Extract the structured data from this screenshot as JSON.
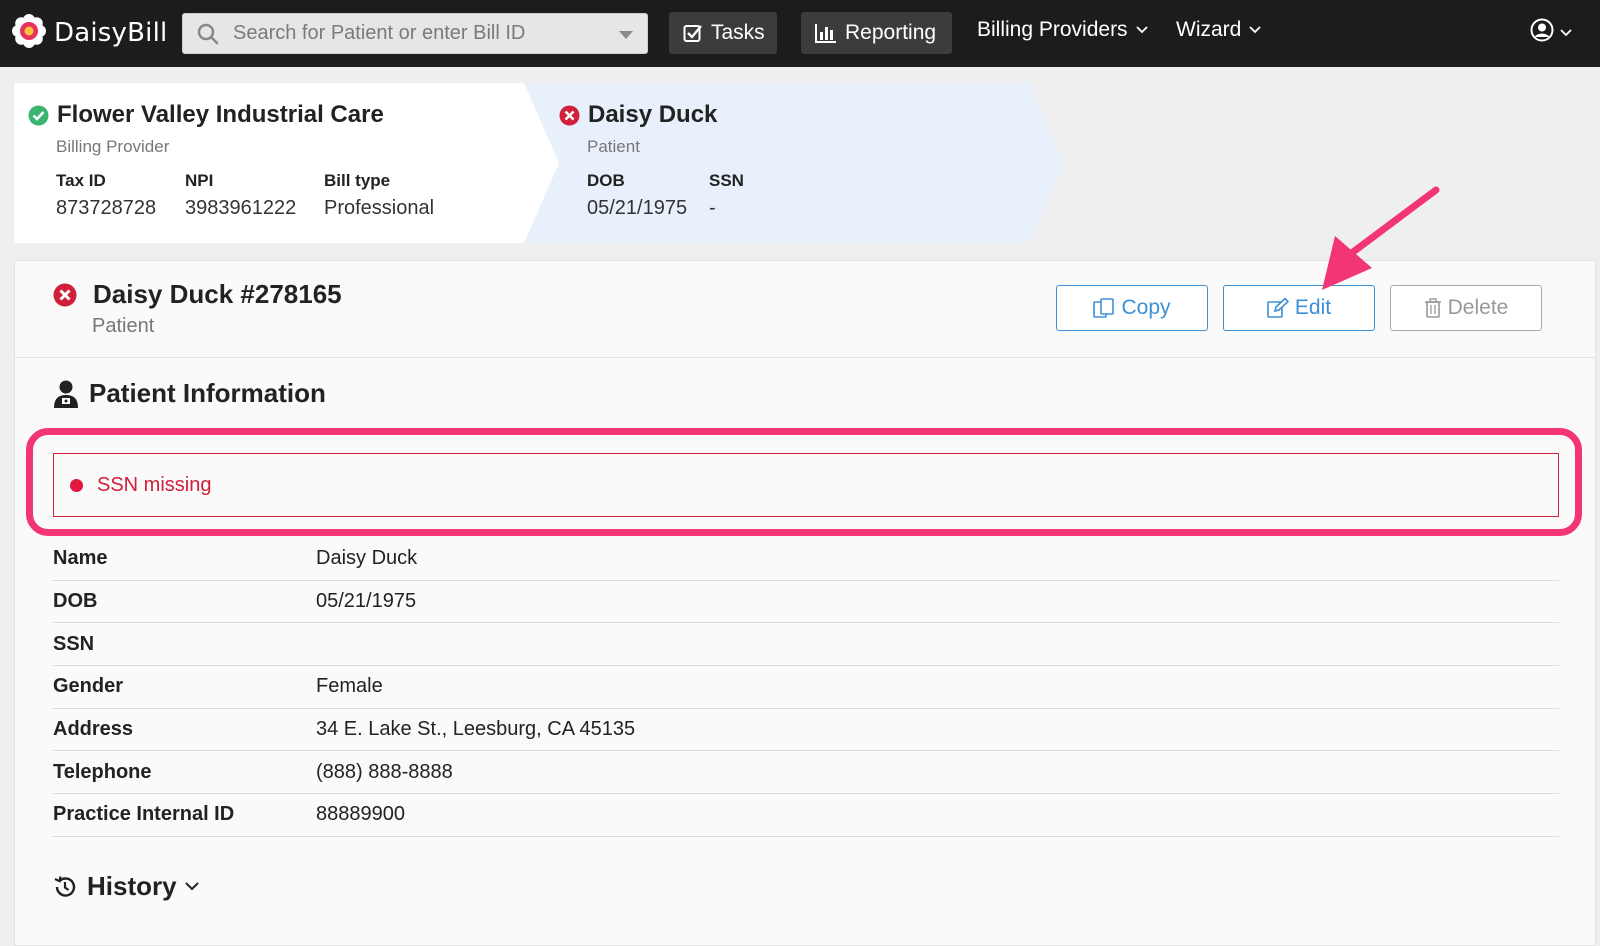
{
  "app": {
    "brand": "DaisyBill",
    "colors": {
      "navbar": "#1c1c1c",
      "accent_blue": "#3d8fd6",
      "error_red": "#d0203a",
      "annotation_pink": "#f23574",
      "success_green": "#3bb56f"
    }
  },
  "navbar": {
    "search": {
      "placeholder": "Search for Patient or enter Bill ID",
      "icon": "search-icon"
    },
    "tasks_label": "Tasks",
    "reporting_label": "Reporting",
    "billing_providers_label": "Billing Providers",
    "wizard_label": "Wizard",
    "user_icon": "user-circle-icon"
  },
  "breadcrumb": {
    "provider": {
      "name": "Flower Valley Industrial Care",
      "status": "valid",
      "subtitle": "Billing Provider",
      "fields": [
        {
          "label": "Tax ID",
          "value": "873728728"
        },
        {
          "label": "NPI",
          "value": "3983961222"
        },
        {
          "label": "Bill type",
          "value": "Professional"
        }
      ]
    },
    "patient": {
      "name": "Daisy Duck",
      "status": "error",
      "subtitle": "Patient",
      "fields": [
        {
          "label": "DOB",
          "value": "05/21/1975"
        },
        {
          "label": "SSN",
          "value": "-"
        }
      ]
    }
  },
  "record": {
    "title": "Daisy Duck #278165",
    "subtitle": "Patient",
    "status": "error",
    "actions": {
      "copy": "Copy",
      "edit": "Edit",
      "delete": "Delete"
    }
  },
  "patient_info": {
    "heading": "Patient Information",
    "alert": "SSN missing",
    "rows": [
      {
        "label": "Name",
        "value": "Daisy Duck"
      },
      {
        "label": "DOB",
        "value": "05/21/1975"
      },
      {
        "label": "SSN",
        "value": ""
      },
      {
        "label": "Gender",
        "value": "Female"
      },
      {
        "label": "Address",
        "value": "34 E. Lake St., Leesburg, CA 45135"
      },
      {
        "label": "Telephone",
        "value": "(888) 888-8888"
      },
      {
        "label": "Practice Internal ID",
        "value": "88889900"
      }
    ]
  },
  "history": {
    "heading": "History"
  }
}
